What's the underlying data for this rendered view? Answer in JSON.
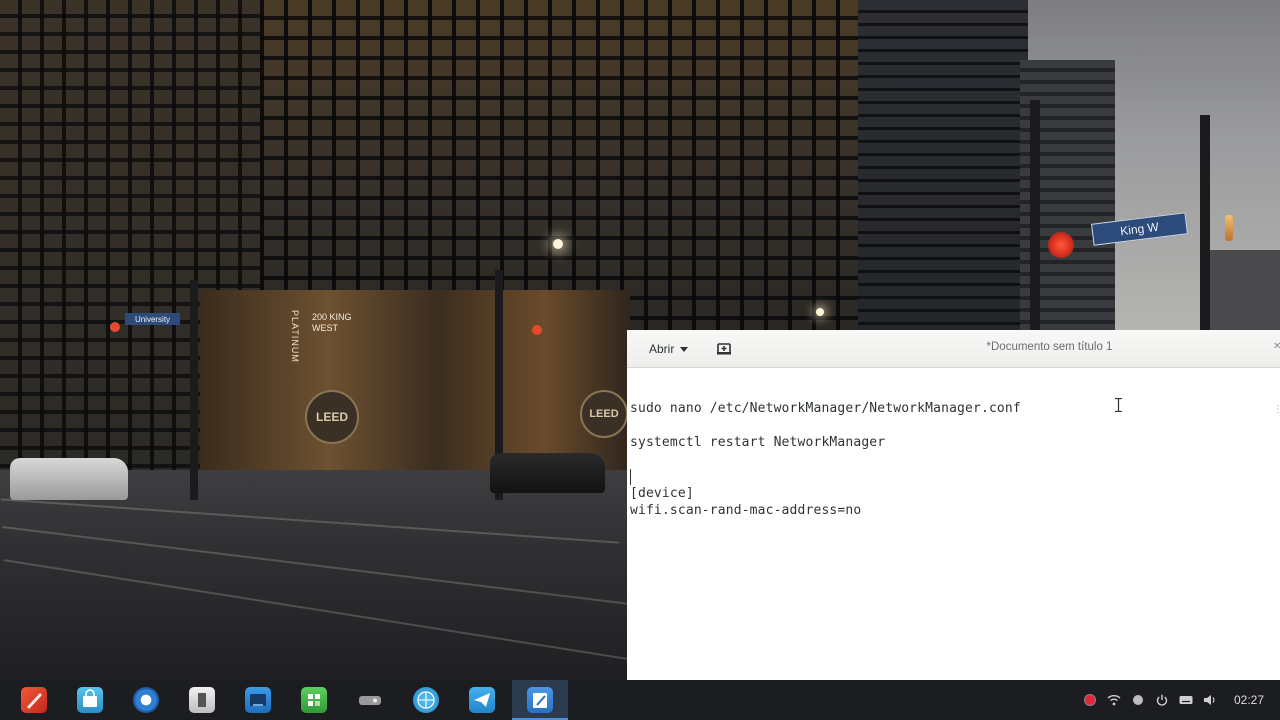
{
  "editor": {
    "open_label": "Abrir",
    "title": "*Documento sem título 1",
    "lines": [
      "sudo nano /etc/NetworkManager/NetworkManager.conf",
      "systemctl restart NetworkManager",
      "[device]",
      "wifi.scan-rand-mac-address=no"
    ]
  },
  "wallpaper": {
    "sign_street": "King W",
    "sign_university": "University",
    "storefront": "200 KING WEST",
    "brand": "PLATINUM",
    "leed": "LEED"
  },
  "taskbar": {
    "apps": [
      {
        "icon": "launcher-icon",
        "color": "#e2422f"
      },
      {
        "icon": "store-icon",
        "color": "#3fa9d8"
      },
      {
        "icon": "browser-icon",
        "color": "#2f7fd4"
      },
      {
        "icon": "file-manager-icon",
        "color": "#d8d8d8"
      },
      {
        "icon": "terminal-icon",
        "color": "#2a8ad8"
      },
      {
        "icon": "spreadsheet-icon",
        "color": "#41b649"
      },
      {
        "icon": "media-icon",
        "color": "#8c8c8c"
      },
      {
        "icon": "web-icon",
        "color": "#2aa3e0"
      },
      {
        "icon": "telegram-icon",
        "color": "#2f9de0"
      },
      {
        "icon": "text-editor-icon",
        "color": "#3a86d8"
      }
    ],
    "active_index": 9,
    "tray_icons": [
      "record-icon",
      "wifi-icon",
      "network-icon",
      "power-icon",
      "keyboard-icon",
      "volume-icon"
    ],
    "clock": "02:27"
  }
}
